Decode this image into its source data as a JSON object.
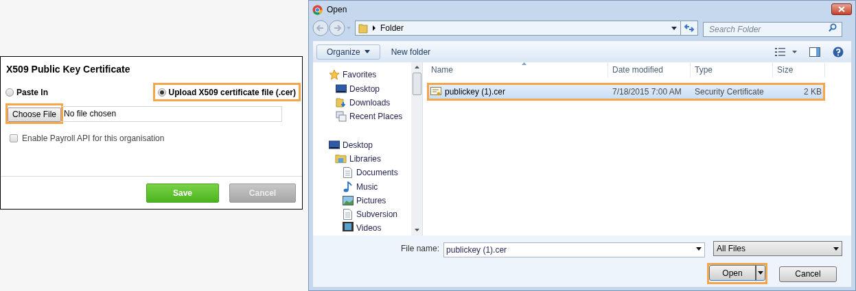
{
  "certificate_panel": {
    "title": "X509 Public Key Certificate",
    "options": [
      {
        "label": "Paste In",
        "selected": false,
        "highlighted": false
      },
      {
        "label": "Upload X509 certificate file (.cer)",
        "selected": true,
        "highlighted": true
      }
    ],
    "choose_file": {
      "label": "Choose File",
      "highlighted": true
    },
    "file_status": "No file chosen",
    "payroll_checkbox": {
      "label": "Enable Payroll API for this organisation",
      "checked": false
    },
    "buttons": [
      {
        "label": "Save",
        "kind": "primary"
      },
      {
        "label": "Cancel",
        "kind": "disabled"
      }
    ]
  },
  "dialog": {
    "title": "Open",
    "address": "Folder",
    "search": {
      "placeholder": "Search Folder"
    },
    "toolbar": [
      "Organize",
      "New folder"
    ],
    "nav_tree": [
      {
        "label": "Favorites",
        "kind": "star",
        "children": [
          {
            "label": "Desktop",
            "kind": "desktop"
          },
          {
            "label": "Downloads",
            "kind": "downloads"
          },
          {
            "label": "Recent Places",
            "kind": "recent"
          }
        ]
      },
      {
        "label": "Desktop",
        "kind": "desktop",
        "children": [
          {
            "label": "Libraries",
            "kind": "libraries",
            "children": [
              {
                "label": "Documents",
                "kind": "document"
              },
              {
                "label": "Music",
                "kind": "music"
              },
              {
                "label": "Pictures",
                "kind": "pictures"
              },
              {
                "label": "Subversion",
                "kind": "document"
              },
              {
                "label": "Videos",
                "kind": "videos"
              }
            ]
          }
        ]
      }
    ],
    "columns": [
      "Name",
      "Date modified",
      "Type",
      "Size"
    ],
    "files": [
      {
        "name": "publickey (1).cer",
        "date_modified": "7/18/2015 7:00 AM",
        "type": "Security Certificate",
        "size": "2 KB",
        "selected": true,
        "highlighted": true
      }
    ],
    "file_name_label": "File name:",
    "file_name": "publickey (1).cer",
    "file_type": "All Files",
    "buttons": [
      {
        "label": "Open",
        "kind": "split",
        "highlighted": true
      },
      {
        "label": "Cancel",
        "kind": "plain",
        "highlighted": false
      }
    ]
  }
}
